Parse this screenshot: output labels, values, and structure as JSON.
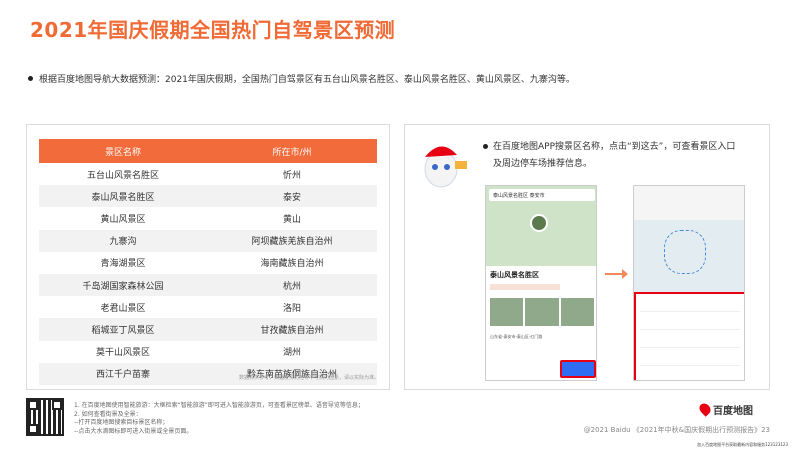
{
  "title": "2021年国庆假期全国热门自驾景区预测",
  "description": "根据百度地图导航大数据预测：2021年国庆假期，全国热门自驾景区有五台山风景名胜区、泰山风景名胜区、黄山风景区、九寨沟等。",
  "table": {
    "headers": [
      "景区名称",
      "所在市/州"
    ],
    "rows": [
      [
        "五台山风景名胜区",
        "忻州"
      ],
      [
        "泰山风景名胜区",
        "泰安"
      ],
      [
        "黄山风景区",
        "黄山"
      ],
      [
        "九寨沟",
        "阿坝藏族羌族自治州"
      ],
      [
        "青海湖景区",
        "海南藏族自治州"
      ],
      [
        "千岛湖国家森林公园",
        "杭州"
      ],
      [
        "老君山景区",
        "洛阳"
      ],
      [
        "稻城亚丁风景区",
        "甘孜藏族自治州"
      ],
      [
        "莫干山风景区",
        "湖州"
      ],
      [
        "西江千户苗寨",
        "黔东南苗族侗族自治州"
      ]
    ],
    "note": "数据仅供参考，如遇疫情防控等不可抗力因素，请以实际为准。"
  },
  "right": {
    "instruction_line1": "在百度地图APP搜景区名称，点击“到这去”，可查看景区入口",
    "instruction_line2": "及周边停车场推荐信息。",
    "phone1_search": "泰山风景名胜区 泰安市",
    "phone1_name": "泰山风景名胜区",
    "phone1_addr": "山东省-泰安市-泰山区-红门路"
  },
  "footer": {
    "note1": "1.  在百度地图使用智能旅游：大框检索“智能旅游”即可进入智能旅游页，可查看景区榜单、语音导览等信息；",
    "note2": "2.  如何查看街景及全景：",
    "note3": "     --打开百度地图搜索目标景区名称；",
    "note4": "     --点击大水滴图标即可进入街景或全景页面。",
    "logo": "百度地图",
    "copyright": "@2021 Baidu 《2021年中秋&国庆假期出行预测报告》23",
    "license": "加入百度地图平台获取最新内容和服务123123123"
  },
  "colors": {
    "accent": "#f06a35",
    "table_header": "#f26b3a",
    "highlight": "#e60012"
  }
}
